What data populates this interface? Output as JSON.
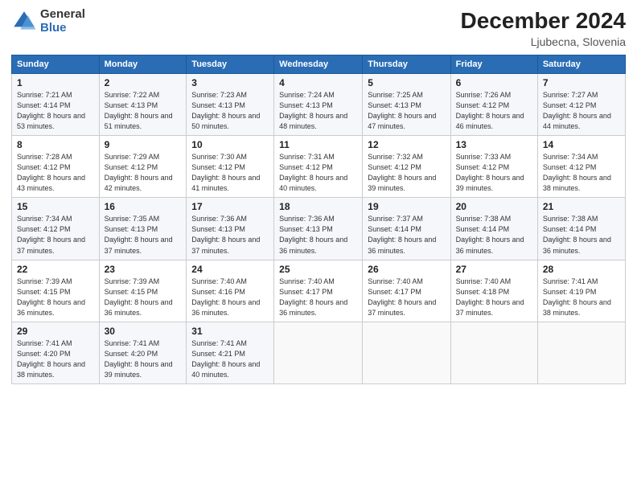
{
  "logo": {
    "general": "General",
    "blue": "Blue"
  },
  "header": {
    "month": "December 2024",
    "location": "Ljubecna, Slovenia"
  },
  "weekdays": [
    "Sunday",
    "Monday",
    "Tuesday",
    "Wednesday",
    "Thursday",
    "Friday",
    "Saturday"
  ],
  "weeks": [
    [
      {
        "day": "1",
        "sunrise": "Sunrise: 7:21 AM",
        "sunset": "Sunset: 4:14 PM",
        "daylight": "Daylight: 8 hours and 53 minutes."
      },
      {
        "day": "2",
        "sunrise": "Sunrise: 7:22 AM",
        "sunset": "Sunset: 4:13 PM",
        "daylight": "Daylight: 8 hours and 51 minutes."
      },
      {
        "day": "3",
        "sunrise": "Sunrise: 7:23 AM",
        "sunset": "Sunset: 4:13 PM",
        "daylight": "Daylight: 8 hours and 50 minutes."
      },
      {
        "day": "4",
        "sunrise": "Sunrise: 7:24 AM",
        "sunset": "Sunset: 4:13 PM",
        "daylight": "Daylight: 8 hours and 48 minutes."
      },
      {
        "day": "5",
        "sunrise": "Sunrise: 7:25 AM",
        "sunset": "Sunset: 4:13 PM",
        "daylight": "Daylight: 8 hours and 47 minutes."
      },
      {
        "day": "6",
        "sunrise": "Sunrise: 7:26 AM",
        "sunset": "Sunset: 4:12 PM",
        "daylight": "Daylight: 8 hours and 46 minutes."
      },
      {
        "day": "7",
        "sunrise": "Sunrise: 7:27 AM",
        "sunset": "Sunset: 4:12 PM",
        "daylight": "Daylight: 8 hours and 44 minutes."
      }
    ],
    [
      {
        "day": "8",
        "sunrise": "Sunrise: 7:28 AM",
        "sunset": "Sunset: 4:12 PM",
        "daylight": "Daylight: 8 hours and 43 minutes."
      },
      {
        "day": "9",
        "sunrise": "Sunrise: 7:29 AM",
        "sunset": "Sunset: 4:12 PM",
        "daylight": "Daylight: 8 hours and 42 minutes."
      },
      {
        "day": "10",
        "sunrise": "Sunrise: 7:30 AM",
        "sunset": "Sunset: 4:12 PM",
        "daylight": "Daylight: 8 hours and 41 minutes."
      },
      {
        "day": "11",
        "sunrise": "Sunrise: 7:31 AM",
        "sunset": "Sunset: 4:12 PM",
        "daylight": "Daylight: 8 hours and 40 minutes."
      },
      {
        "day": "12",
        "sunrise": "Sunrise: 7:32 AM",
        "sunset": "Sunset: 4:12 PM",
        "daylight": "Daylight: 8 hours and 39 minutes."
      },
      {
        "day": "13",
        "sunrise": "Sunrise: 7:33 AM",
        "sunset": "Sunset: 4:12 PM",
        "daylight": "Daylight: 8 hours and 39 minutes."
      },
      {
        "day": "14",
        "sunrise": "Sunrise: 7:34 AM",
        "sunset": "Sunset: 4:12 PM",
        "daylight": "Daylight: 8 hours and 38 minutes."
      }
    ],
    [
      {
        "day": "15",
        "sunrise": "Sunrise: 7:34 AM",
        "sunset": "Sunset: 4:12 PM",
        "daylight": "Daylight: 8 hours and 37 minutes."
      },
      {
        "day": "16",
        "sunrise": "Sunrise: 7:35 AM",
        "sunset": "Sunset: 4:13 PM",
        "daylight": "Daylight: 8 hours and 37 minutes."
      },
      {
        "day": "17",
        "sunrise": "Sunrise: 7:36 AM",
        "sunset": "Sunset: 4:13 PM",
        "daylight": "Daylight: 8 hours and 37 minutes."
      },
      {
        "day": "18",
        "sunrise": "Sunrise: 7:36 AM",
        "sunset": "Sunset: 4:13 PM",
        "daylight": "Daylight: 8 hours and 36 minutes."
      },
      {
        "day": "19",
        "sunrise": "Sunrise: 7:37 AM",
        "sunset": "Sunset: 4:14 PM",
        "daylight": "Daylight: 8 hours and 36 minutes."
      },
      {
        "day": "20",
        "sunrise": "Sunrise: 7:38 AM",
        "sunset": "Sunset: 4:14 PM",
        "daylight": "Daylight: 8 hours and 36 minutes."
      },
      {
        "day": "21",
        "sunrise": "Sunrise: 7:38 AM",
        "sunset": "Sunset: 4:14 PM",
        "daylight": "Daylight: 8 hours and 36 minutes."
      }
    ],
    [
      {
        "day": "22",
        "sunrise": "Sunrise: 7:39 AM",
        "sunset": "Sunset: 4:15 PM",
        "daylight": "Daylight: 8 hours and 36 minutes."
      },
      {
        "day": "23",
        "sunrise": "Sunrise: 7:39 AM",
        "sunset": "Sunset: 4:15 PM",
        "daylight": "Daylight: 8 hours and 36 minutes."
      },
      {
        "day": "24",
        "sunrise": "Sunrise: 7:40 AM",
        "sunset": "Sunset: 4:16 PM",
        "daylight": "Daylight: 8 hours and 36 minutes."
      },
      {
        "day": "25",
        "sunrise": "Sunrise: 7:40 AM",
        "sunset": "Sunset: 4:17 PM",
        "daylight": "Daylight: 8 hours and 36 minutes."
      },
      {
        "day": "26",
        "sunrise": "Sunrise: 7:40 AM",
        "sunset": "Sunset: 4:17 PM",
        "daylight": "Daylight: 8 hours and 37 minutes."
      },
      {
        "day": "27",
        "sunrise": "Sunrise: 7:40 AM",
        "sunset": "Sunset: 4:18 PM",
        "daylight": "Daylight: 8 hours and 37 minutes."
      },
      {
        "day": "28",
        "sunrise": "Sunrise: 7:41 AM",
        "sunset": "Sunset: 4:19 PM",
        "daylight": "Daylight: 8 hours and 38 minutes."
      }
    ],
    [
      {
        "day": "29",
        "sunrise": "Sunrise: 7:41 AM",
        "sunset": "Sunset: 4:20 PM",
        "daylight": "Daylight: 8 hours and 38 minutes."
      },
      {
        "day": "30",
        "sunrise": "Sunrise: 7:41 AM",
        "sunset": "Sunset: 4:20 PM",
        "daylight": "Daylight: 8 hours and 39 minutes."
      },
      {
        "day": "31",
        "sunrise": "Sunrise: 7:41 AM",
        "sunset": "Sunset: 4:21 PM",
        "daylight": "Daylight: 8 hours and 40 minutes."
      },
      null,
      null,
      null,
      null
    ]
  ]
}
